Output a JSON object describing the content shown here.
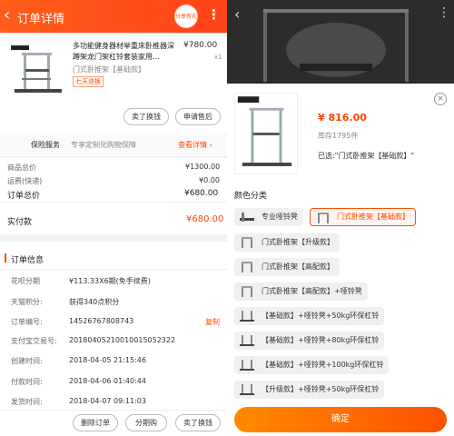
{
  "header": {
    "title": "订单详情",
    "badge_text": "分享有礼"
  },
  "product": {
    "name": "多功能健身器材举重床卧推器深蹲架龙门架杠铃套装家用…",
    "price": "¥780.00",
    "qty": "x1",
    "spec": "门式卧推架【基础款】",
    "tag": "七天退换",
    "btn_exchange": "卖了换钱",
    "btn_after_sale": "申请售后"
  },
  "insurance": {
    "label": "保险服务",
    "desc": "专享定制化购物保障",
    "link": "查看详情 ›"
  },
  "totals": {
    "goods_label": "商品总价",
    "goods_value": "¥1300.00",
    "ship_label": "运费(快递)",
    "ship_value": "¥0.00",
    "order_label": "订单总价",
    "order_value": "¥680.00",
    "paid_label": "实付款",
    "paid_value": "¥680.00"
  },
  "order_info": {
    "title": "订单信息",
    "rows": [
      {
        "label": "花呗分期",
        "value": "¥113.33X6期(免手续费)"
      },
      {
        "label": "天猫积分:",
        "value": "获得340点积分"
      },
      {
        "label": "订单编号:",
        "value": "14526767808743",
        "action": "复制"
      },
      {
        "label": "支付宝交易号:",
        "value": "20180405210010015052322"
      },
      {
        "label": "创建时间:",
        "value": "2018-04-05 21:15:46"
      },
      {
        "label": "付款时间:",
        "value": "2018-04-06 01:40:44"
      },
      {
        "label": "发货时间:",
        "value": "2018-04-07 09:11:03"
      }
    ]
  },
  "bottom_buttons": {
    "delete": "删除订单",
    "installment": "分期购",
    "sell": "卖了换钱"
  },
  "sheet": {
    "price": "¥ 816.00",
    "stock": "库存1795件",
    "selected": "已选:\"门式卧推架【基础款】\"",
    "section_title": "颜色分类",
    "variants": [
      "专业哑铃凳",
      "门式卧推架【基础款】",
      "门式卧推架【升级款】",
      "门式卧推架【高配款】",
      "门式卧推架【高配款】+哑铃凳",
      "【基础款】+哑铃凳+50kg环保杠铃",
      "【基础款】+哑铃凳+80kg环保杠铃",
      "【基础款】+哑铃凳+100kg环保杠铃",
      "【升级款】+哑铃凳+50kg环保杠铃"
    ],
    "confirm": "确定"
  },
  "colors": {
    "accent": "#ff5000",
    "price": "#ff4400"
  }
}
